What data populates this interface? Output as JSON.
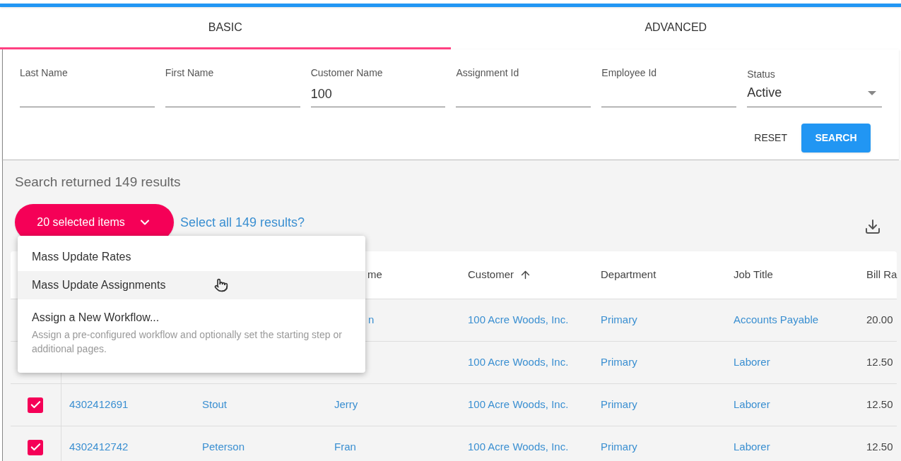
{
  "tabs": [
    {
      "label": "BASIC",
      "selected": true
    },
    {
      "label": "ADVANCED",
      "selected": false
    }
  ],
  "filters": [
    {
      "label": "Last Name",
      "kind": "text"
    },
    {
      "label": "First Name",
      "kind": "text"
    },
    {
      "label": "Customer Name",
      "kind": "text",
      "value": "100"
    },
    {
      "label": "Assignment Id",
      "kind": "text"
    },
    {
      "label": "Employee Id",
      "kind": "text"
    },
    {
      "label": "Status",
      "kind": "select",
      "value": "Active"
    }
  ],
  "buttons": [
    {
      "label": "RESET",
      "kind": "text"
    },
    {
      "label": "SEARCH",
      "kind": "primary"
    }
  ],
  "results_summary": "Search returned 149 results",
  "selection_button": "20 selected items",
  "select_all_link": "Select all 149 results?",
  "actions_menu": [
    {
      "label": "Mass Update Rates",
      "highlighted": false
    },
    {
      "label": "Mass Update Assignments",
      "highlighted": true
    },
    {
      "label": "Assign a New Workflow...",
      "description": "Assign a pre-configured workflow and optionally set the starting step or additional pages.",
      "highlighted": false
    }
  ],
  "table": {
    "columns": [
      {
        "kind": "covered"
      },
      {
        "kind": "covered"
      },
      {
        "kind": "covered"
      },
      {
        "kind": "partial",
        "label": "me"
      },
      {
        "kind": "sortable",
        "label": "Customer",
        "sort_ascending": true
      },
      {
        "kind": "plain",
        "label": "Department"
      },
      {
        "kind": "plain",
        "label": "Job Title"
      },
      {
        "kind": "plain",
        "label": "Bill Ra"
      }
    ],
    "rows": [
      {
        "cells": [
          {
            "kind": "covered"
          },
          {
            "kind": "covered"
          },
          {
            "kind": "covered"
          },
          {
            "kind": "partial",
            "text": "n"
          },
          {
            "kind": "link",
            "text": "100 Acre Woods, Inc."
          },
          {
            "kind": "link",
            "text": "Primary"
          },
          {
            "kind": "link",
            "text": "Accounts Payable"
          },
          {
            "kind": "text",
            "text": "20.00"
          }
        ]
      },
      {
        "cells": [
          {
            "kind": "covered"
          },
          {
            "kind": "covered"
          },
          {
            "kind": "covered"
          },
          {
            "kind": "covered"
          },
          {
            "kind": "link",
            "text": "100 Acre Woods, Inc."
          },
          {
            "kind": "link",
            "text": "Primary"
          },
          {
            "kind": "link",
            "text": "Laborer"
          },
          {
            "kind": "text",
            "text": "12.50"
          }
        ]
      },
      {
        "cells": [
          {
            "kind": "checkbox",
            "checked": true
          },
          {
            "kind": "link",
            "text": "4302412691"
          },
          {
            "kind": "link",
            "text": "Stout"
          },
          {
            "kind": "link",
            "text": "Jerry"
          },
          {
            "kind": "link",
            "text": "100 Acre Woods, Inc."
          },
          {
            "kind": "link",
            "text": "Primary"
          },
          {
            "kind": "link",
            "text": "Laborer"
          },
          {
            "kind": "text",
            "text": "12.50"
          }
        ]
      },
      {
        "cells": [
          {
            "kind": "checkbox",
            "checked": true
          },
          {
            "kind": "link",
            "text": "4302412742"
          },
          {
            "kind": "link",
            "text": "Peterson"
          },
          {
            "kind": "link",
            "text": "Fran"
          },
          {
            "kind": "link",
            "text": "100 Acre Woods, Inc."
          },
          {
            "kind": "link",
            "text": "Primary"
          },
          {
            "kind": "link",
            "text": "Laborer"
          },
          {
            "kind": "text",
            "text": "12.50"
          }
        ]
      }
    ]
  }
}
